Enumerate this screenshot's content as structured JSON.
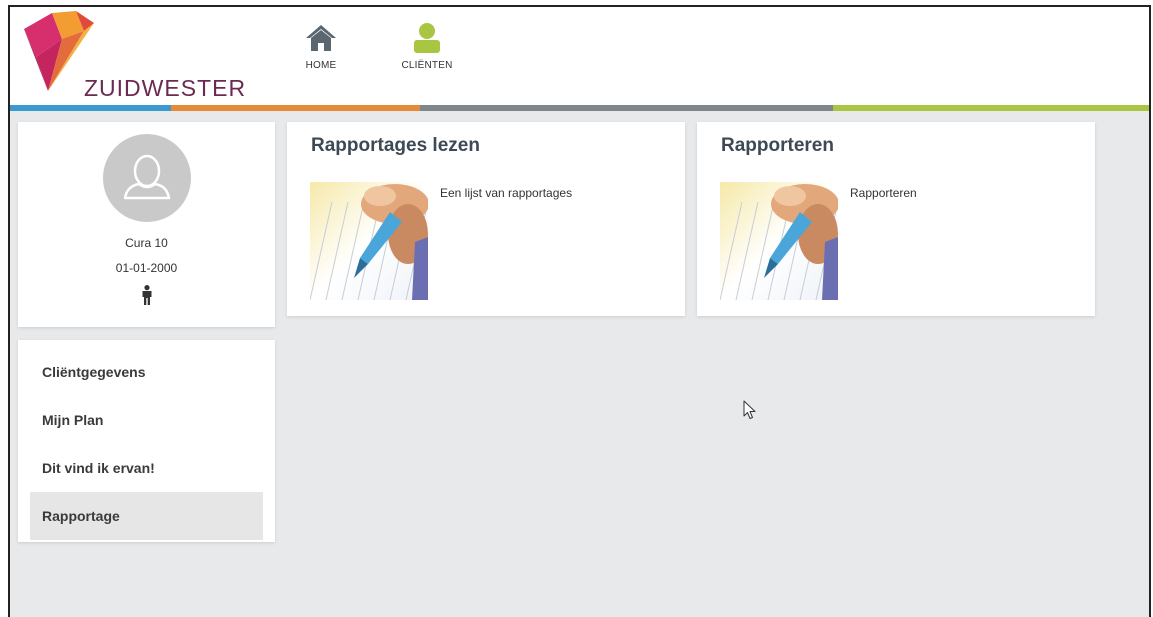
{
  "brand": {
    "name": "ZUIDWESTER"
  },
  "nav": [
    {
      "label": "HOME",
      "icon": "home-icon"
    },
    {
      "label": "CLIËNTEN",
      "icon": "client-user-icon"
    }
  ],
  "colors": {
    "bar": [
      "#3a9ad0",
      "#e5893b",
      "#7f878c",
      "#a9c643"
    ],
    "client_green": "#a9c643",
    "home_gray": "#5a6670"
  },
  "client": {
    "name": "Cura 10",
    "dob": "01-01-2000",
    "gender_icon": "male-person-icon",
    "avatar_icon": "user-avatar-icon"
  },
  "menu": {
    "items": [
      {
        "label": "Cliëntgegevens",
        "active": false
      },
      {
        "label": "Mijn Plan",
        "active": false
      },
      {
        "label": "Dit vind ik ervan!",
        "active": false
      },
      {
        "label": "Rapportage",
        "active": true
      }
    ]
  },
  "tiles": [
    {
      "title": "Rapportages lezen",
      "description": "Een lijst van rapportages",
      "image": "pen-writing-image"
    },
    {
      "title": "Rapporteren",
      "description": "Rapporteren",
      "image": "pen-writing-image"
    }
  ]
}
